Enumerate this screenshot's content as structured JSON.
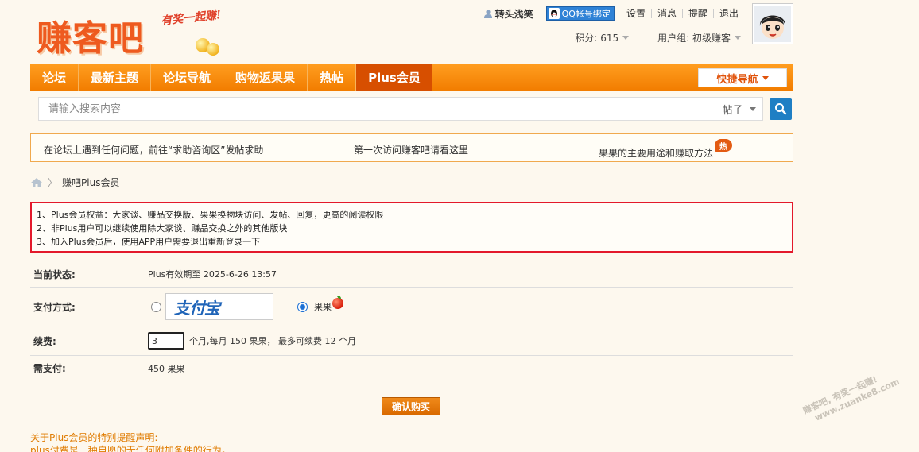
{
  "header": {
    "logo_text": "赚客吧",
    "logo_slogan": "有奖一起赚!"
  },
  "userbar": {
    "username": "转头浅笑",
    "qq_bind": "QQ帐号绑定",
    "links": [
      "设置",
      "消息",
      "提醒",
      "退出"
    ]
  },
  "stats": {
    "points": "积分: 615",
    "group": "用户组: 初级赚客"
  },
  "nav": {
    "items": [
      "论坛",
      "最新主题",
      "论坛导航",
      "购物返果果",
      "热帖",
      "Plus会员"
    ],
    "quick_nav": "快捷导航"
  },
  "search": {
    "placeholder": "请输入搜索内容",
    "type": "帖子"
  },
  "notice": {
    "items": [
      "在论坛上遇到任何问题，前往“求助咨询区”发帖求助",
      "第一次访问赚客吧请看这里",
      "果果的主要用途和赚取方法"
    ],
    "hot_badge": "热"
  },
  "breadcrumb": {
    "current": "赚吧Plus会员"
  },
  "rules": [
    "1、Plus会员权益：大家谈、赚品交换版、果果换物块访问、发帖、回复，更高的阅读权限",
    "2、非Plus用户可以继续使用除大家谈、赚品交换之外的其他版块",
    "3、加入Plus会员后，使用APP用户需要退出重新登录一下"
  ],
  "form": {
    "status_label": "当前状态:",
    "status_value": "Plus有效期至 2025-6-26 13:57",
    "pay_label": "支付方式:",
    "alipay_text": "支付宝",
    "guoguo_label": "果果",
    "renew_label": "续费:",
    "renew_qty": "3",
    "renew_desc": "个月,每月 150 果果， 最多可续费 12 个月",
    "need_label": "需支付:",
    "need_value": "450 果果",
    "confirm_button": "确认购买"
  },
  "disclaimer": {
    "title": "关于Plus会员的特别提醒声明:",
    "line1": "plus付费是一种自愿的无任何附加条件的行为。"
  },
  "watermark": {
    "line1": "赚客吧, 有奖一起赚!",
    "line2": "www.zuanke8.com"
  },
  "colors": {
    "nav_orange": "#f27d00",
    "nav_active": "#d74f00",
    "rules_border": "#e3192b",
    "search_button": "#1f7fc4"
  }
}
